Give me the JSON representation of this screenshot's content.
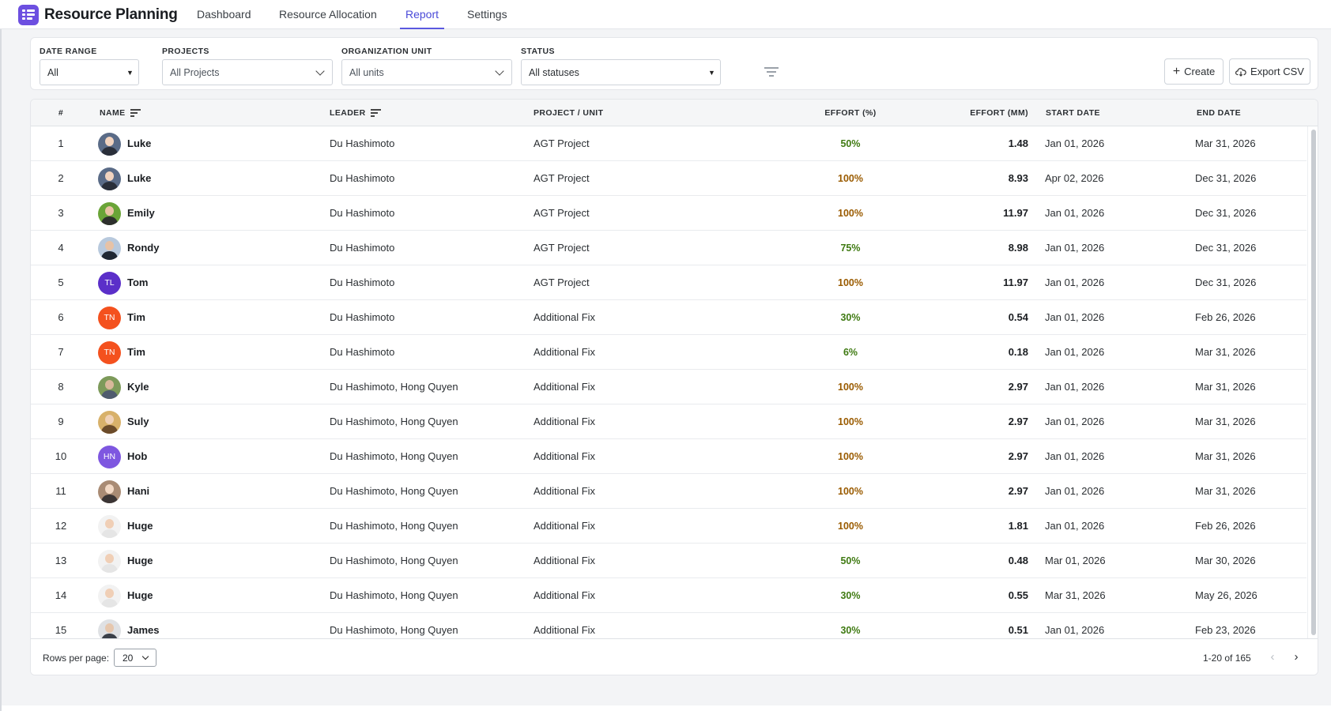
{
  "app": {
    "title": "Resource Planning"
  },
  "nav": {
    "tabs": [
      {
        "label": "Dashboard",
        "active": false
      },
      {
        "label": "Resource Allocation",
        "active": false
      },
      {
        "label": "Report",
        "active": true
      },
      {
        "label": "Settings",
        "active": false
      }
    ]
  },
  "filters": {
    "date_range": {
      "label": "DATE RANGE",
      "value": "All"
    },
    "projects": {
      "label": "PROJECTS",
      "placeholder": "All Projects"
    },
    "org_unit": {
      "label": "ORGANIZATION UNIT",
      "placeholder": "All units"
    },
    "status": {
      "label": "STATUS",
      "value": "All statuses"
    },
    "create_label": "Create",
    "export_label": "Export CSV"
  },
  "table": {
    "columns": {
      "idx": "#",
      "name": "NAME",
      "leader": "LEADER",
      "project": "PROJECT / UNIT",
      "effort_pct": "EFFORT (%)",
      "effort_mm": "EFFORT (MM)",
      "start": "START DATE",
      "end": "END DATE"
    },
    "rows": [
      {
        "idx": "1",
        "name": "Luke",
        "avatar": "photo-dark",
        "leader": "Du Hashimoto",
        "project": "AGT Project",
        "effort_pct": "50%",
        "effort_mm": "1.48",
        "start": "Jan 01, 2026",
        "end": "Mar 31, 2026"
      },
      {
        "idx": "2",
        "name": "Luke",
        "avatar": "photo-dark",
        "leader": "Du Hashimoto",
        "project": "AGT Project",
        "effort_pct": "100%",
        "effort_mm": "8.93",
        "start": "Apr 02, 2026",
        "end": "Dec 31, 2026"
      },
      {
        "idx": "3",
        "name": "Emily",
        "avatar": "photo-green",
        "leader": "Du Hashimoto",
        "project": "AGT Project",
        "effort_pct": "100%",
        "effort_mm": "11.97",
        "start": "Jan 01, 2026",
        "end": "Dec 31, 2026"
      },
      {
        "idx": "4",
        "name": "Rondy",
        "avatar": "photo-blue",
        "leader": "Du Hashimoto",
        "project": "AGT Project",
        "effort_pct": "75%",
        "effort_mm": "8.98",
        "start": "Jan 01, 2026",
        "end": "Dec 31, 2026"
      },
      {
        "idx": "5",
        "name": "Tom",
        "avatar": "initials",
        "initials": "TL",
        "avatar_color": "#5b2fc9",
        "leader": "Du Hashimoto",
        "project": "AGT Project",
        "effort_pct": "100%",
        "effort_mm": "11.97",
        "start": "Jan 01, 2026",
        "end": "Dec 31, 2026"
      },
      {
        "idx": "6",
        "name": "Tim",
        "avatar": "initials",
        "initials": "TN",
        "avatar_color": "#f4511e",
        "leader": "Du Hashimoto",
        "project": "Additional Fix",
        "effort_pct": "30%",
        "effort_mm": "0.54",
        "start": "Jan 01, 2026",
        "end": "Feb 26, 2026"
      },
      {
        "idx": "7",
        "name": "Tim",
        "avatar": "initials",
        "initials": "TN",
        "avatar_color": "#f4511e",
        "leader": "Du Hashimoto",
        "project": "Additional Fix",
        "effort_pct": "6%",
        "effort_mm": "0.18",
        "start": "Jan 01, 2026",
        "end": "Mar 31, 2026"
      },
      {
        "idx": "8",
        "name": "Kyle",
        "avatar": "photo-nature",
        "leader": "Du Hashimoto, Hong Quyen",
        "project": "Additional Fix",
        "effort_pct": "100%",
        "effort_mm": "2.97",
        "start": "Jan 01, 2026",
        "end": "Mar 31, 2026"
      },
      {
        "idx": "9",
        "name": "Suly",
        "avatar": "photo-warm",
        "leader": "Du Hashimoto, Hong Quyen",
        "project": "Additional Fix",
        "effort_pct": "100%",
        "effort_mm": "2.97",
        "start": "Jan 01, 2026",
        "end": "Mar 31, 2026"
      },
      {
        "idx": "10",
        "name": "Hob",
        "avatar": "initials",
        "initials": "HN",
        "avatar_color": "#7e57e0",
        "leader": "Du Hashimoto, Hong Quyen",
        "project": "Additional Fix",
        "effort_pct": "100%",
        "effort_mm": "2.97",
        "start": "Jan 01, 2026",
        "end": "Mar 31, 2026"
      },
      {
        "idx": "11",
        "name": "Hani",
        "avatar": "photo-tan",
        "leader": "Du Hashimoto, Hong Quyen",
        "project": "Additional Fix",
        "effort_pct": "100%",
        "effort_mm": "2.97",
        "start": "Jan 01, 2026",
        "end": "Mar 31, 2026"
      },
      {
        "idx": "12",
        "name": "Huge",
        "avatar": "photo-light",
        "leader": "Du Hashimoto, Hong Quyen",
        "project": "Additional Fix",
        "effort_pct": "100%",
        "effort_mm": "1.81",
        "start": "Jan 01, 2026",
        "end": "Feb 26, 2026"
      },
      {
        "idx": "13",
        "name": "Huge",
        "avatar": "photo-light",
        "leader": "Du Hashimoto, Hong Quyen",
        "project": "Additional Fix",
        "effort_pct": "50%",
        "effort_mm": "0.48",
        "start": "Mar 01, 2026",
        "end": "Mar 30, 2026"
      },
      {
        "idx": "14",
        "name": "Huge",
        "avatar": "photo-light",
        "leader": "Du Hashimoto, Hong Quyen",
        "project": "Additional Fix",
        "effort_pct": "30%",
        "effort_mm": "0.55",
        "start": "Mar 31, 2026",
        "end": "May 26, 2026"
      },
      {
        "idx": "15",
        "name": "James",
        "avatar": "photo-gray",
        "leader": "Du Hashimoto, Hong Quyen",
        "project": "Additional Fix",
        "effort_pct": "30%",
        "effort_mm": "0.51",
        "start": "Jan 01, 2026",
        "end": "Feb 23, 2026"
      }
    ]
  },
  "pagination": {
    "rows_per_page_label": "Rows per page:",
    "rows_per_page": "20",
    "range_text": "1-20 of 165",
    "prev_icon": "‹",
    "next_icon": "›"
  },
  "colors": {
    "accent": "#5a58e0",
    "effort_full": "#9a5b00",
    "effort_partial": "#3f7a12"
  }
}
